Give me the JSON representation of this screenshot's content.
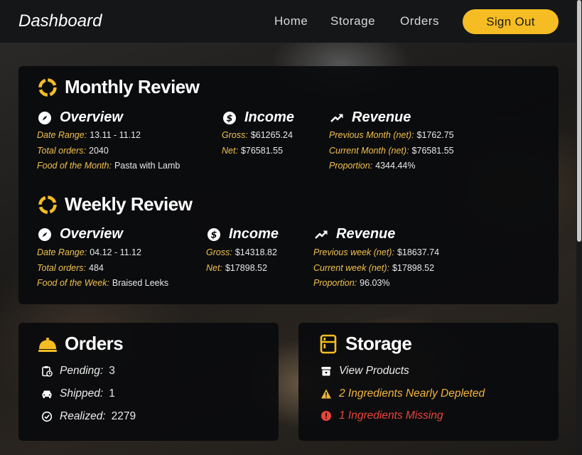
{
  "navbar": {
    "brand": "Dashboard",
    "links": [
      "Home",
      "Storage",
      "Orders"
    ],
    "sign_out": "Sign Out"
  },
  "monthly": {
    "title": "Monthly Review",
    "overview": {
      "title": "Overview",
      "rows": [
        {
          "k": "Date Range:",
          "v": "13.11 - 11.12"
        },
        {
          "k": "Total orders:",
          "v": "2040"
        },
        {
          "k": "Food of the Month:",
          "v": "Pasta with Lamb"
        }
      ]
    },
    "income": {
      "title": "Income",
      "rows": [
        {
          "k": "Gross:",
          "v": "$61265.24"
        },
        {
          "k": "Net:",
          "v": "$76581.55"
        }
      ]
    },
    "revenue": {
      "title": "Revenue",
      "rows": [
        {
          "k": "Previous Month (net):",
          "v": "$1762.75"
        },
        {
          "k": "Current Month (net):",
          "v": "$76581.55"
        },
        {
          "k": "Proportion:",
          "v": "4344.44%"
        }
      ]
    }
  },
  "weekly": {
    "title": "Weekly Review",
    "overview": {
      "title": "Overview",
      "rows": [
        {
          "k": "Date Range:",
          "v": "04.12 - 11.12"
        },
        {
          "k": "Total orders:",
          "v": "484"
        },
        {
          "k": "Food of the Week:",
          "v": "Braised Leeks"
        }
      ]
    },
    "income": {
      "title": "Income",
      "rows": [
        {
          "k": "Gross:",
          "v": "$14318.82"
        },
        {
          "k": "Net:",
          "v": "$17898.52"
        }
      ]
    },
    "revenue": {
      "title": "Revenue",
      "rows": [
        {
          "k": "Previous week (net):",
          "v": "$18637.74"
        },
        {
          "k": "Current week (net):",
          "v": "$17898.52"
        },
        {
          "k": "Proportion:",
          "v": "96.03%"
        }
      ]
    }
  },
  "orders": {
    "title": "Orders",
    "items": [
      {
        "icon": "clipboard-clock-icon",
        "k": "Pending:",
        "v": "3"
      },
      {
        "icon": "truck-icon",
        "k": "Shipped:",
        "v": "1"
      },
      {
        "icon": "check-circle-icon",
        "k": "Realized:",
        "v": "2279"
      }
    ]
  },
  "storage": {
    "title": "Storage",
    "items": [
      {
        "icon": "archive-box-icon",
        "text": "View Products",
        "status": "normal"
      },
      {
        "icon": "warning-triangle-icon",
        "text": "2 Ingredients Nearly Depleted",
        "status": "warning"
      },
      {
        "icon": "alert-circle-icon",
        "text": "1 Ingredients Missing",
        "status": "danger"
      }
    ]
  },
  "colors": {
    "accent": "#f5bd23",
    "label": "#f2c14e",
    "warning": "#f3b43f",
    "danger": "#e9453b",
    "card": "#0a0b0d",
    "navbar": "#141618"
  }
}
